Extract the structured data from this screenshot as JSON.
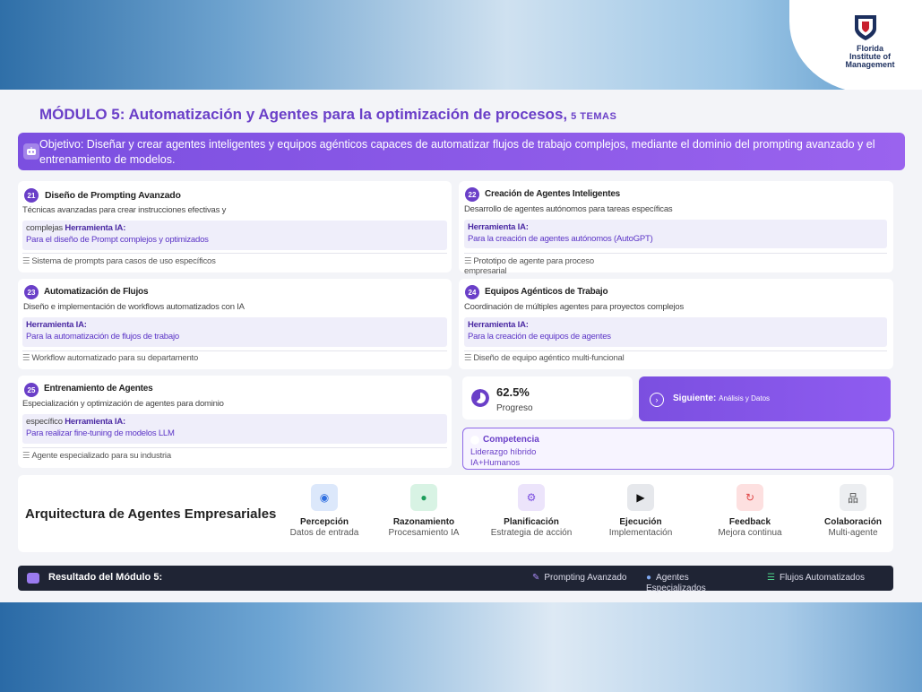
{
  "brand": {
    "logo_lines": [
      "Florida",
      "Institute of",
      "Management"
    ]
  },
  "module": {
    "title": "MÓDULO 5: Automatización y Agentes para la optimización de procesos,",
    "topics": "5 TEMAS"
  },
  "objective": {
    "text": "Objetivo: Diseñar y crear agentes inteligentes y equipos agénticos capaces de automatizar flujos de trabajo complejos, mediante el dominio del prompting avanzado y el entrenamiento de modelos."
  },
  "cards": [
    {
      "num": "21",
      "title": "Diseño de Prompting Avanzado",
      "desc": "Técnicas avanzadas para crear instrucciones efectivas y",
      "tool_pre": "complejas",
      "tool_label": "Herramienta IA:",
      "tool_value": "Para el diseño de Prompt complejos y optimizados",
      "project": "Sistema de prompts para casos de uso específicos"
    },
    {
      "num": "22",
      "title": "Creación de Agentes Inteligentes",
      "desc": "Desarrollo de agentes autónomos para tareas específicas",
      "tool_pre": "",
      "tool_label": "Herramienta IA:",
      "tool_value": "Para la creación de agentes autónomos (AutoGPT)",
      "project": "Prototipo de agente para proceso empresarial"
    },
    {
      "num": "23",
      "title": "Automatización de Flujos",
      "desc": "Diseño e implementación de workflows automatizados con IA",
      "tool_pre": "",
      "tool_label": "Herramienta IA:",
      "tool_value": "Para la automatización de flujos de trabajo",
      "project": "Workflow automatizado para su departamento"
    },
    {
      "num": "24",
      "title": "Equipos Agénticos de Trabajo",
      "desc": "Coordinación de múltiples agentes para proyectos complejos",
      "tool_pre": "",
      "tool_label": "Herramienta IA:",
      "tool_value": "Para la creación de equipos de agentes",
      "project": "Diseño de equipo agéntico multi-funcional"
    },
    {
      "num": "25",
      "title": "Entrenamiento de Agentes",
      "desc": "Especialización y optimización de agentes para dominio",
      "tool_pre": "específico",
      "tool_label": "Herramienta IA:",
      "tool_value": "Para realizar fine-tuning de modelos LLM",
      "project": "Agente especializado para su industria"
    }
  ],
  "progress": {
    "value": "62.5%",
    "label": "Progreso",
    "fraction": 0.625
  },
  "next": {
    "label": "Siguiente:",
    "value": "Análisis y Datos"
  },
  "competencia": {
    "title": "Competencia",
    "line1": "Liderazgo híbrido",
    "line2": "IA+Humanos"
  },
  "architecture": {
    "title": "Arquitectura de Agentes Empresariales",
    "steps": [
      {
        "label": "Percepción",
        "sub": "Datos de entrada",
        "icon": "eye-icon",
        "bg": "#dce8fb",
        "fg": "#2f6fe0"
      },
      {
        "label": "Razonamiento",
        "sub": "Procesamiento IA",
        "icon": "brain-icon",
        "bg": "#d8f3e4",
        "fg": "#1e9e5c"
      },
      {
        "label": "Planificación",
        "sub": "Estrategia de acción",
        "icon": "gears-icon",
        "bg": "#ece4fb",
        "fg": "#7b4fe0"
      },
      {
        "label": "Ejecución",
        "sub": "Implementación",
        "icon": "play-icon",
        "bg": "#e6e8ec",
        "fg": "#111"
      },
      {
        "label": "Feedback",
        "sub": "Mejora continua",
        "icon": "sync-icon",
        "bg": "#fde0e0",
        "fg": "#e04848"
      },
      {
        "label": "Colaboración",
        "sub": "Multi-agente",
        "icon": "network-icon",
        "bg": "#eceef1",
        "fg": "#555"
      }
    ]
  },
  "result": {
    "title": "Resultado del Módulo 5:",
    "badges": [
      {
        "icon": "pencil-icon",
        "text": "Prompting Avanzado"
      },
      {
        "icon": "robot-icon",
        "text": "Agentes Especializados"
      },
      {
        "icon": "list-icon",
        "text": "Flujos Automatizados"
      }
    ]
  }
}
